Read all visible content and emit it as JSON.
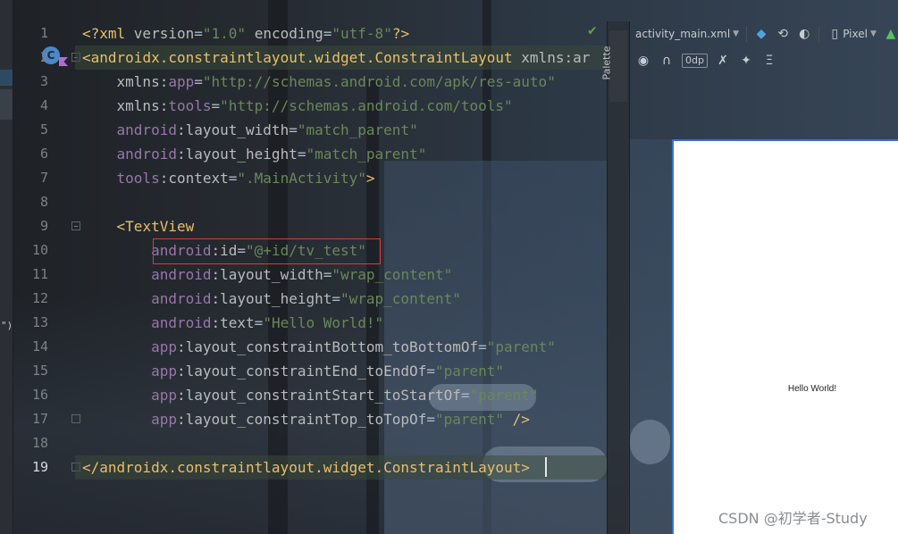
{
  "editor": {
    "lines": [
      {
        "num": "1",
        "tokens": [
          [
            "punct",
            "<?"
          ],
          [
            "tag",
            "xml "
          ],
          [
            "attr",
            "version"
          ],
          [
            "plain",
            "="
          ],
          [
            "val",
            "\"1.0\""
          ],
          [
            "plain",
            " "
          ],
          [
            "attr",
            "encoding"
          ],
          [
            "plain",
            "="
          ],
          [
            "val",
            "\"utf-8\""
          ],
          [
            "punct",
            "?>"
          ]
        ]
      },
      {
        "num": "2",
        "tokens": [
          [
            "punct",
            "<"
          ],
          [
            "tag",
            "androidx.constraintlayout.widget.ConstraintLayout"
          ],
          [
            "plain",
            " "
          ],
          [
            "attr",
            "xmlns:ar"
          ]
        ]
      },
      {
        "num": "3",
        "tokens": [
          [
            "plain",
            "    "
          ],
          [
            "attr",
            "xmlns:"
          ],
          [
            "attrns",
            "app"
          ],
          [
            "plain",
            "="
          ],
          [
            "val",
            "\"http://schemas.android.com/apk/res-auto\""
          ]
        ]
      },
      {
        "num": "4",
        "tokens": [
          [
            "plain",
            "    "
          ],
          [
            "attr",
            "xmlns:"
          ],
          [
            "attrns",
            "tools"
          ],
          [
            "plain",
            "="
          ],
          [
            "val",
            "\"http://schemas.android.com/tools\""
          ]
        ]
      },
      {
        "num": "5",
        "tokens": [
          [
            "plain",
            "    "
          ],
          [
            "attrns",
            "android"
          ],
          [
            "attr",
            ":layout_width"
          ],
          [
            "plain",
            "="
          ],
          [
            "val",
            "\"match_parent\""
          ]
        ]
      },
      {
        "num": "6",
        "tokens": [
          [
            "plain",
            "    "
          ],
          [
            "attrns",
            "android"
          ],
          [
            "attr",
            ":layout_height"
          ],
          [
            "plain",
            "="
          ],
          [
            "val",
            "\"match_parent\""
          ]
        ]
      },
      {
        "num": "7",
        "tokens": [
          [
            "plain",
            "    "
          ],
          [
            "attrns",
            "tools"
          ],
          [
            "attr",
            ":context"
          ],
          [
            "plain",
            "="
          ],
          [
            "val",
            "\".MainActivity\""
          ],
          [
            "punct",
            ">"
          ]
        ]
      },
      {
        "num": "8",
        "tokens": []
      },
      {
        "num": "9",
        "tokens": [
          [
            "plain",
            "    "
          ],
          [
            "punct",
            "<"
          ],
          [
            "tag",
            "TextView"
          ]
        ]
      },
      {
        "num": "10",
        "tokens": [
          [
            "plain",
            "        "
          ],
          [
            "attrns",
            "android"
          ],
          [
            "attr",
            ":id"
          ],
          [
            "plain",
            "="
          ],
          [
            "val",
            "\"@+id/tv_test\""
          ]
        ]
      },
      {
        "num": "11",
        "tokens": [
          [
            "plain",
            "        "
          ],
          [
            "attrns",
            "android"
          ],
          [
            "attr",
            ":layout_width"
          ],
          [
            "plain",
            "="
          ],
          [
            "val",
            "\"wrap_content\""
          ]
        ]
      },
      {
        "num": "12",
        "tokens": [
          [
            "plain",
            "        "
          ],
          [
            "attrns",
            "android"
          ],
          [
            "attr",
            ":layout_height"
          ],
          [
            "plain",
            "="
          ],
          [
            "val",
            "\"wrap_content\""
          ]
        ]
      },
      {
        "num": "13",
        "tokens": [
          [
            "plain",
            "        "
          ],
          [
            "attrns",
            "android"
          ],
          [
            "attr",
            ":text"
          ],
          [
            "plain",
            "="
          ],
          [
            "val",
            "\"Hello World!\""
          ]
        ]
      },
      {
        "num": "14",
        "tokens": [
          [
            "plain",
            "        "
          ],
          [
            "attrns",
            "app"
          ],
          [
            "attr",
            ":layout_constraintBottom_toBottomOf"
          ],
          [
            "plain",
            "="
          ],
          [
            "val",
            "\"parent\""
          ]
        ]
      },
      {
        "num": "15",
        "tokens": [
          [
            "plain",
            "        "
          ],
          [
            "attrns",
            "app"
          ],
          [
            "attr",
            ":layout_constraintEnd_toEndOf"
          ],
          [
            "plain",
            "="
          ],
          [
            "val",
            "\"parent\""
          ]
        ]
      },
      {
        "num": "16",
        "tokens": [
          [
            "plain",
            "        "
          ],
          [
            "attrns",
            "app"
          ],
          [
            "attr",
            ":layout_constraintStart_toStartOf"
          ],
          [
            "plain",
            "="
          ],
          [
            "val",
            "\"parent\""
          ]
        ]
      },
      {
        "num": "17",
        "tokens": [
          [
            "plain",
            "        "
          ],
          [
            "attrns",
            "app"
          ],
          [
            "attr",
            ":layout_constraintTop_toTopOf"
          ],
          [
            "plain",
            "="
          ],
          [
            "val",
            "\"parent\""
          ],
          [
            "plain",
            " "
          ],
          [
            "punct",
            "/>"
          ]
        ]
      },
      {
        "num": "18",
        "tokens": []
      },
      {
        "num": "19",
        "tokens": [
          [
            "punct",
            "</"
          ],
          [
            "tag",
            "androidx.constraintlayout.widget.ConstraintLayout"
          ],
          [
            "punct",
            ">"
          ]
        ]
      }
    ],
    "current_line": "19"
  },
  "palette": {
    "label": "Palette"
  },
  "design_toolbar": {
    "file_dropdown": "activity_main.xml",
    "device_dropdown": "Pixel",
    "margin_value": "0dp",
    "icons": {
      "layers": "layers-icon",
      "orientation": "rotate-icon",
      "theme": "theme-icon",
      "device": "phone-icon",
      "api": "android-icon",
      "visibility": "eye-icon",
      "magnet": "magnet-icon",
      "clear_constraints": "clear-constraints-icon",
      "infer": "magic-wand-icon",
      "align": "align-icon"
    }
  },
  "preview": {
    "text": "Hello World!"
  },
  "left_strip": {
    "glyph": "\")"
  },
  "watermark": "CSDN @初学者-Study",
  "colors": {
    "tag": "#e8bf6a",
    "attr": "#bababa",
    "namespace": "#9876aa",
    "value": "#6a8759",
    "highlight_box": "#d83b3b"
  }
}
